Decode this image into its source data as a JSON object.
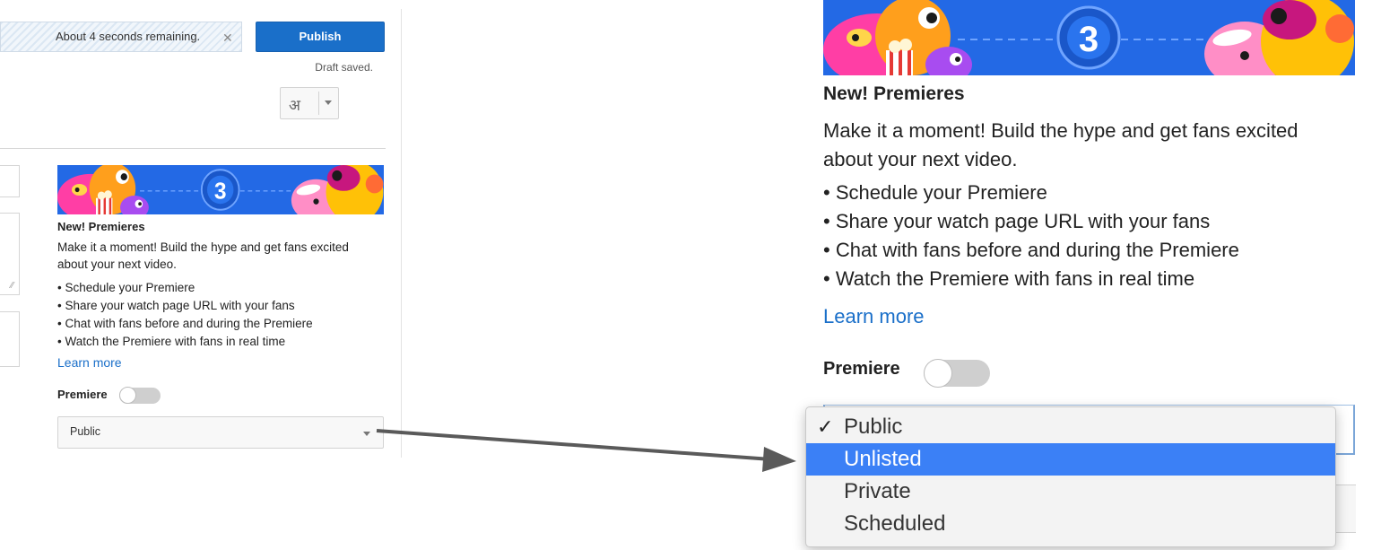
{
  "upload": {
    "status_text": "About 4 seconds remaining.",
    "close_icon": "close-icon",
    "publish_label": "Publish",
    "draft_status": "Draft saved.",
    "language_glyph": "अ"
  },
  "premieres_promo": {
    "title": "New! Premieres",
    "description": "Make it a moment! Build the hype and get fans excited about your next video.",
    "features": [
      "Schedule your Premiere",
      "Share your watch page URL with your fans",
      "Chat with fans before and during the Premiere",
      "Watch the Premiere with fans in real time"
    ],
    "learn_more": "Learn more",
    "countdown_number": "3"
  },
  "premiere_toggle": {
    "label": "Premiere",
    "enabled": false
  },
  "visibility": {
    "selected": "Public",
    "options": [
      "Public",
      "Unlisted",
      "Private",
      "Scheduled"
    ],
    "highlighted": "Unlisted"
  },
  "colors": {
    "accent_blue": "#1a6fc9",
    "highlight_blue": "#3b80f6",
    "banner_blue": "#1f64e0",
    "toggle_off": "#cfcfcf"
  }
}
